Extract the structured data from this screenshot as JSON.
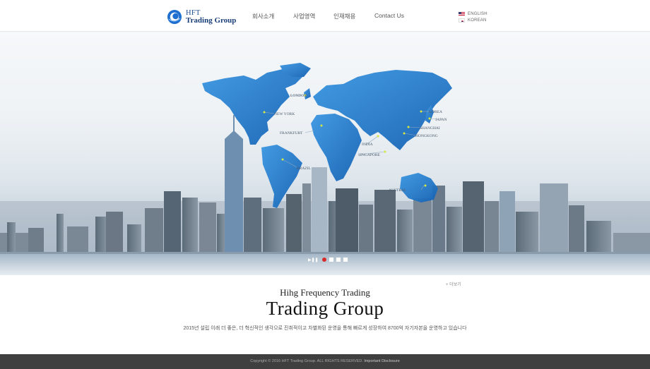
{
  "logo": {
    "line1": "HFT",
    "line2": "Trading Group",
    "icon": "globe-ring-logo"
  },
  "nav": {
    "items": [
      "회사소개",
      "사업영역",
      "인재채용",
      "Contact Us"
    ]
  },
  "lang": {
    "english": "ENGLISH",
    "korean": "KOREAN"
  },
  "hero": {
    "cities": [
      "LONDON",
      "NEW YORK",
      "FRANKFURT",
      "BRAZIL",
      "INDIA",
      "SINGAPORE",
      "KOREA",
      "JAPAN",
      "SHANGHAI",
      "HONGKONG",
      "AUSTRAL"
    ],
    "slider": {
      "play_icon": "play-pause-icon",
      "slides": 4,
      "active": 1
    }
  },
  "content": {
    "more": "+ 더보기",
    "subtitle": "Hihg Frequency Trading",
    "title": "Trading Group",
    "description": "2015년 설립 이래 더 좋은, 더 혁신적인 생각으로 진취적이고 차별화된 운영을 통해 빠르게 성장하여 8700억 자기자본을 운영하고 있습니다"
  },
  "footer": {
    "copyright": "Copyright © 2016 HFT Trading Group. ALL RIGHTS RESERVED.",
    "disclosure": "Important Disclosure"
  },
  "colors": {
    "map_blue": "#1f74c8",
    "accent_dot": "#d72a2a",
    "footer_bg": "#3f3f3f"
  }
}
